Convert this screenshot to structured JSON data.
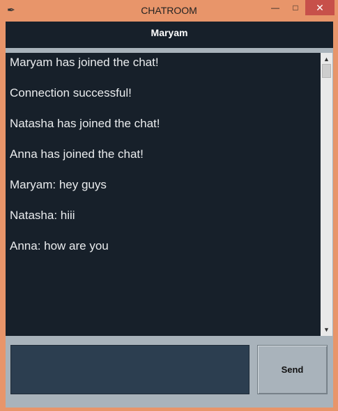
{
  "window": {
    "title": "CHATROOM",
    "app_icon": "feather-icon",
    "controls": {
      "minimize": "minimize-icon",
      "maximize": "maximize-icon",
      "close": "close-icon"
    }
  },
  "header": {
    "title": "Maryam"
  },
  "chat": {
    "messages": [
      "Maryam has joined the chat!",
      "Connection successful!",
      "Natasha has joined the chat!",
      "Anna has joined the chat!",
      "Maryam: hey guys",
      "Natasha: hiii",
      "Anna: how are you"
    ]
  },
  "composer": {
    "message_value": "",
    "send_label": "Send"
  },
  "colors": {
    "title_bar": "#e8956a",
    "chat_background": "#17202a",
    "panel_background": "#a9b3bb",
    "entry_background": "#2c3e50",
    "text": "#eaecee"
  }
}
